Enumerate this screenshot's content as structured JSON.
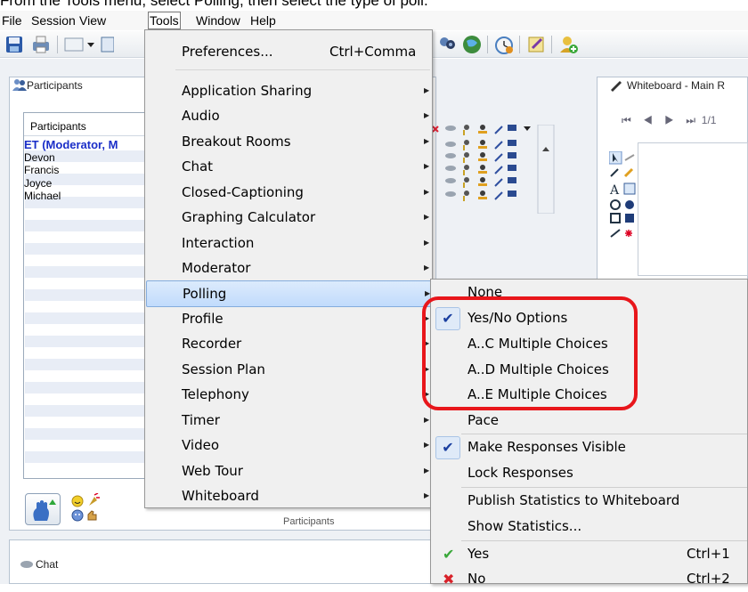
{
  "instruction": {
    "text": "From the Tools menu, select Polling, then select the type of poll."
  },
  "menubar": {
    "items": [
      "File",
      "Session",
      "View",
      "Tools",
      "Window",
      "Help"
    ]
  },
  "participants": {
    "panel_title": "Participants",
    "column_header": "Participants",
    "rows": [
      "ET (Moderator, M",
      "Devon",
      "Francis",
      "Joyce",
      "Michael"
    ],
    "caption": "Participants"
  },
  "chat": {
    "title": "Chat"
  },
  "whiteboard": {
    "title": "Whiteboard - Main R",
    "page": "1/1"
  },
  "tools_menu": {
    "items": [
      {
        "label": "Preferences...",
        "shortcut": "Ctrl+Comma",
        "submenu": false
      },
      {
        "label": "Application Sharing",
        "submenu": true
      },
      {
        "label": "Audio",
        "submenu": true
      },
      {
        "label": "Breakout Rooms",
        "submenu": true
      },
      {
        "label": "Chat",
        "submenu": true
      },
      {
        "label": "Closed-Captioning",
        "submenu": true
      },
      {
        "label": "Graphing Calculator",
        "submenu": true
      },
      {
        "label": "Interaction",
        "submenu": true
      },
      {
        "label": "Moderator",
        "submenu": true
      },
      {
        "label": "Polling",
        "submenu": true,
        "highlighted": true
      },
      {
        "label": "Profile",
        "submenu": true
      },
      {
        "label": "Recorder",
        "submenu": true
      },
      {
        "label": "Session Plan",
        "submenu": true
      },
      {
        "label": "Telephony",
        "submenu": true
      },
      {
        "label": "Timer",
        "submenu": true
      },
      {
        "label": "Video",
        "submenu": true
      },
      {
        "label": "Web Tour",
        "submenu": true
      },
      {
        "label": "Whiteboard",
        "submenu": true
      }
    ]
  },
  "polling_menu": {
    "items": [
      {
        "label": "None"
      },
      {
        "label": "Yes/No Options",
        "checked": true
      },
      {
        "label": "A..C Multiple Choices"
      },
      {
        "label": "A..D Multiple Choices"
      },
      {
        "label": "A..E Multiple Choices"
      },
      {
        "label": "Pace"
      },
      {
        "label": "Make Responses Visible",
        "checked": true
      },
      {
        "label": "Lock Responses"
      },
      {
        "label": "Publish Statistics to Whiteboard"
      },
      {
        "label": "Show Statistics..."
      },
      {
        "label": "Yes",
        "shortcut": "Ctrl+1",
        "mark": "green-check"
      },
      {
        "label": "No",
        "shortcut": "Ctrl+2",
        "mark": "red-x"
      }
    ]
  },
  "colors": {
    "callout": "#e8161b",
    "menu_highlight": "#c1dbfc",
    "moderator_name": "#1a2ec8"
  }
}
